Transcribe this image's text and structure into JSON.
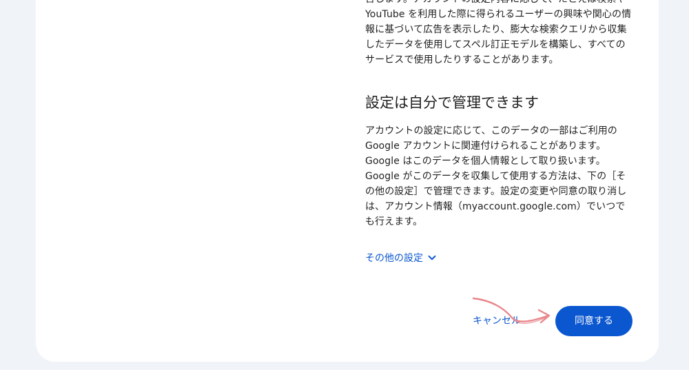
{
  "consent": {
    "intro_paragraph": "含します。アカウントの設定内容に応じて、たとえば検索や YouTube を利用した際に得られるユーザーの興味や関心の情報に基づいて広告を表示したり、膨大な検索クエリから収集したデータを使用してスペル訂正モデルを構築し、すべてのサービスで使用したりすることがあります。",
    "section_heading": "設定は自分で管理できます",
    "section_paragraph": "アカウントの設定に応じて、このデータの一部はご利用の Google アカウントに関連付けられることがあります。Google はこのデータを個人情報として取り扱います。Google がこのデータを収集して使用する方法は、下の［その他の設定］で管理できます。設定の変更や同意の取り消しは、アカウント情報（myaccount.google.com）でいつでも行えます。",
    "more_settings_label": "その他の設定",
    "cancel_label": "キャンセル",
    "agree_label": "同意する"
  },
  "colors": {
    "accent": "#0b57d0",
    "page_background": "#f0f4f9",
    "card_background": "#ffffff",
    "annotation_arrow": "#e8868b"
  },
  "icons": {
    "more_settings": "chevron-down-icon",
    "annotation": "curved-arrow-icon"
  }
}
